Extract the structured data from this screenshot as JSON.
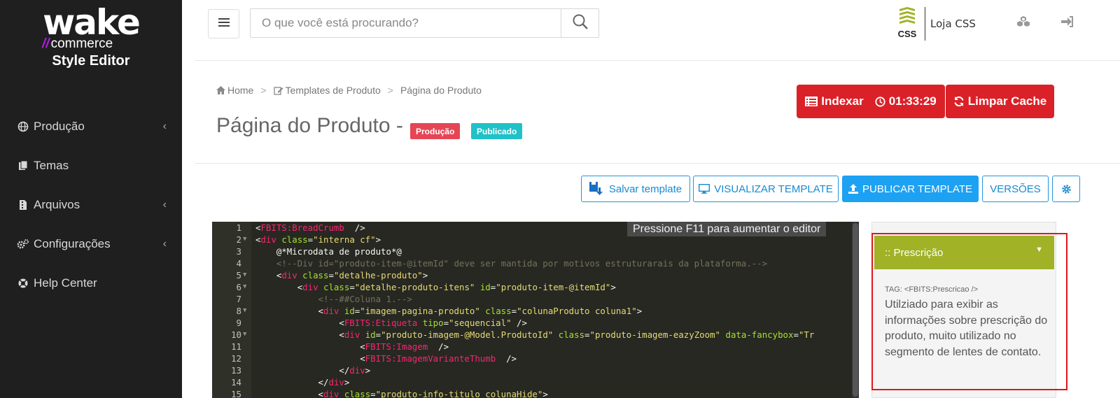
{
  "brand": {
    "logo_main": "wake",
    "logo_sub_slashes": "//",
    "logo_sub": "commerce",
    "app_name": "Style Editor"
  },
  "sidebar": {
    "items": [
      {
        "label": "Produção",
        "icon": "globe-icon",
        "has_chevron": true
      },
      {
        "label": "Temas",
        "icon": "files-icon",
        "has_chevron": false
      },
      {
        "label": "Arquivos",
        "icon": "file-archive-icon",
        "has_chevron": true
      },
      {
        "label": "Configurações",
        "icon": "gears-icon",
        "has_chevron": true
      },
      {
        "label": "Help Center",
        "icon": "lifebuoy-icon",
        "has_chevron": false
      }
    ],
    "chevron": "‹"
  },
  "topbar": {
    "search_placeholder": "O que você está procurando?",
    "css_logo_text": "CSS",
    "store_name": "Loja CSS"
  },
  "breadcrumb": {
    "items": [
      "Home",
      "Templates de Produto",
      "Página do Produto"
    ],
    "separator": ">"
  },
  "page": {
    "title": "Página do Produto -",
    "badges": [
      {
        "label": "Produção",
        "color": "#e64555"
      },
      {
        "label": "Publicado",
        "color": "#20c1c8"
      }
    ]
  },
  "actions": {
    "index_label": "Indexar",
    "timer": "01:33:29",
    "clear_cache_label": "Limpar Cache"
  },
  "toolbar": {
    "save_label": "Salvar template",
    "preview_label": "VISUALIZAR TEMPLATE",
    "publish_label": "PUBLICAR TEMPLATE",
    "versions_label": "VERSÕES"
  },
  "editor": {
    "hint": "Pressione F11 para aumentar o editor",
    "lines": [
      {
        "n": "1",
        "fold": false,
        "indent": "",
        "tokens": [
          [
            "t-plain",
            "<"
          ],
          [
            "t-tag",
            "FBITS:BreadCrumb"
          ],
          [
            "t-plain",
            "  />"
          ]
        ]
      },
      {
        "n": "2",
        "fold": true,
        "indent": "",
        "tokens": [
          [
            "t-plain",
            "<"
          ],
          [
            "t-tag",
            "div"
          ],
          [
            "t-plain",
            " "
          ],
          [
            "t-attr",
            "class"
          ],
          [
            "t-plain",
            "="
          ],
          [
            "t-str",
            "\"interna cf\""
          ],
          [
            "t-plain",
            ">"
          ]
        ]
      },
      {
        "n": "3",
        "fold": false,
        "indent": "    ",
        "tokens": [
          [
            "t-plain",
            "@*Microdata de produto*@"
          ]
        ]
      },
      {
        "n": "4",
        "fold": false,
        "indent": "    ",
        "tokens": [
          [
            "t-com",
            "<!--Div id=\"produto-item-@itemId\" deve ser mantida por motivos estruturarais da plataforma.-->"
          ]
        ]
      },
      {
        "n": "5",
        "fold": true,
        "indent": "    ",
        "tokens": [
          [
            "t-plain",
            "<"
          ],
          [
            "t-tag",
            "div"
          ],
          [
            "t-plain",
            " "
          ],
          [
            "t-attr",
            "class"
          ],
          [
            "t-plain",
            "="
          ],
          [
            "t-str",
            "\"detalhe-produto\""
          ],
          [
            "t-plain",
            ">"
          ]
        ]
      },
      {
        "n": "6",
        "fold": true,
        "indent": "        ",
        "tokens": [
          [
            "t-plain",
            "<"
          ],
          [
            "t-tag",
            "div"
          ],
          [
            "t-plain",
            " "
          ],
          [
            "t-attr",
            "class"
          ],
          [
            "t-plain",
            "="
          ],
          [
            "t-str",
            "\"detalhe-produto-itens\""
          ],
          [
            "t-plain",
            " "
          ],
          [
            "t-attr",
            "id"
          ],
          [
            "t-plain",
            "="
          ],
          [
            "t-str",
            "\"produto-item-@itemId\""
          ],
          [
            "t-plain",
            ">"
          ]
        ]
      },
      {
        "n": "7",
        "fold": false,
        "indent": "            ",
        "tokens": [
          [
            "t-com",
            "<!--##Coluna 1.-->"
          ]
        ]
      },
      {
        "n": "8",
        "fold": true,
        "indent": "            ",
        "tokens": [
          [
            "t-plain",
            "<"
          ],
          [
            "t-tag",
            "div"
          ],
          [
            "t-plain",
            " "
          ],
          [
            "t-attr",
            "id"
          ],
          [
            "t-plain",
            "="
          ],
          [
            "t-str",
            "\"imagem-pagina-produto\""
          ],
          [
            "t-plain",
            " "
          ],
          [
            "t-attr",
            "class"
          ],
          [
            "t-plain",
            "="
          ],
          [
            "t-str",
            "\"colunaProduto coluna1\""
          ],
          [
            "t-plain",
            ">"
          ]
        ]
      },
      {
        "n": "9",
        "fold": false,
        "indent": "                ",
        "tokens": [
          [
            "t-plain",
            "<"
          ],
          [
            "t-tag",
            "FBITS:Etiqueta"
          ],
          [
            "t-plain",
            " "
          ],
          [
            "t-attr",
            "tipo"
          ],
          [
            "t-plain",
            "="
          ],
          [
            "t-str",
            "\"sequencial\""
          ],
          [
            "t-plain",
            " />"
          ]
        ]
      },
      {
        "n": "10",
        "fold": true,
        "indent": "                ",
        "tokens": [
          [
            "t-plain",
            "<"
          ],
          [
            "t-tag",
            "div"
          ],
          [
            "t-plain",
            " "
          ],
          [
            "t-attr",
            "id"
          ],
          [
            "t-plain",
            "="
          ],
          [
            "t-str",
            "\"produto-imagem-@Model.ProdutoId\""
          ],
          [
            "t-plain",
            " "
          ],
          [
            "t-attr",
            "class"
          ],
          [
            "t-plain",
            "="
          ],
          [
            "t-str",
            "\"produto-imagem-eazyZoom\""
          ],
          [
            "t-plain",
            " "
          ],
          [
            "t-attr",
            "data-fancybox"
          ],
          [
            "t-plain",
            "="
          ],
          [
            "t-str",
            "\"Tr"
          ]
        ]
      },
      {
        "n": "11",
        "fold": false,
        "indent": "                    ",
        "tokens": [
          [
            "t-plain",
            "<"
          ],
          [
            "t-tag",
            "FBITS:Imagem"
          ],
          [
            "t-plain",
            "  />"
          ]
        ]
      },
      {
        "n": "12",
        "fold": false,
        "indent": "                    ",
        "tokens": [
          [
            "t-plain",
            "<"
          ],
          [
            "t-tag",
            "FBITS:ImagemVarianteThumb"
          ],
          [
            "t-plain",
            "  />"
          ]
        ]
      },
      {
        "n": "13",
        "fold": false,
        "indent": "                ",
        "tokens": [
          [
            "t-plain",
            "</"
          ],
          [
            "t-tag",
            "div"
          ],
          [
            "t-plain",
            ">"
          ]
        ]
      },
      {
        "n": "14",
        "fold": false,
        "indent": "            ",
        "tokens": [
          [
            "t-plain",
            "</"
          ],
          [
            "t-tag",
            "div"
          ],
          [
            "t-plain",
            ">"
          ]
        ]
      },
      {
        "n": "15",
        "fold": false,
        "indent": "            ",
        "tokens": [
          [
            "t-plain",
            "<"
          ],
          [
            "t-tag",
            "div"
          ],
          [
            "t-plain",
            " "
          ],
          [
            "t-attr",
            "class"
          ],
          [
            "t-plain",
            "="
          ],
          [
            "t-str",
            "\"produto-info-titulo colunaHide\""
          ],
          [
            "t-plain",
            ">"
          ]
        ]
      }
    ]
  },
  "side_panel": {
    "title": ":: Prescrição",
    "tag": "TAG: <FBITS:Prescricao />",
    "description": "Utilziado para exibir as informações sobre prescrição do produto, muito utilizado no segmento de lentes de contato."
  },
  "colors": {
    "sidebar_bg": "#1f1f1f",
    "accent_red": "#da2128",
    "accent_blue": "#1da1f2",
    "panel_green": "#a1b227",
    "highlight_red": "#e0161c"
  }
}
